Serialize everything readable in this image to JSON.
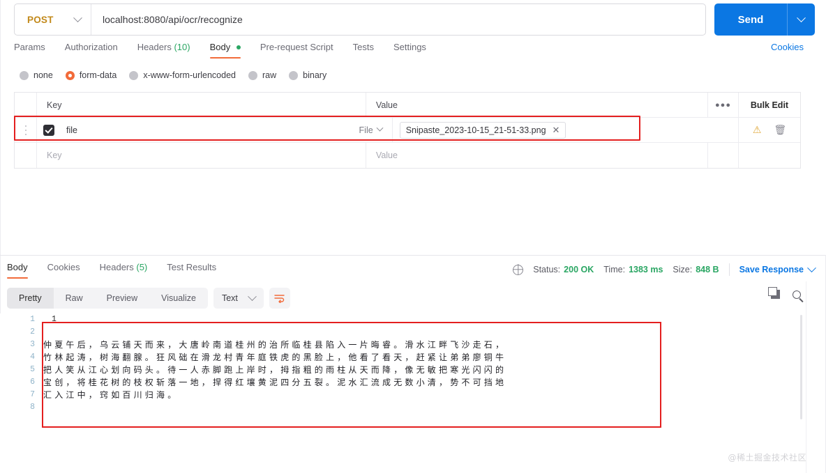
{
  "request": {
    "method": "POST",
    "url": "localhost:8080/api/ocr/recognize",
    "send_label": "Send",
    "tabs": [
      {
        "label": "Params",
        "active": false
      },
      {
        "label": "Authorization",
        "active": false
      },
      {
        "label": "Headers",
        "count": "(10)",
        "active": false
      },
      {
        "label": "Body",
        "active": true,
        "dot": true
      },
      {
        "label": "Pre-request Script",
        "active": false
      },
      {
        "label": "Tests",
        "active": false
      },
      {
        "label": "Settings",
        "active": false
      }
    ],
    "cookies_link": "Cookies",
    "body_types": [
      {
        "label": "none",
        "selected": false
      },
      {
        "label": "form-data",
        "selected": true
      },
      {
        "label": "x-www-form-urlencoded",
        "selected": false
      },
      {
        "label": "raw",
        "selected": false
      },
      {
        "label": "binary",
        "selected": false
      }
    ],
    "table": {
      "headers": {
        "key": "Key",
        "value": "Value",
        "more": "●●●",
        "bulk_edit": "Bulk Edit"
      },
      "rows": [
        {
          "checked": true,
          "key": "file",
          "key_type": "File",
          "value_chip": "Snipaste_2023-10-15_21-51-33.png",
          "chip_close": "✕",
          "warn": "⚠",
          "trash": "🗑"
        }
      ],
      "empty_row": {
        "key_placeholder": "Key",
        "value_placeholder": "Value"
      }
    }
  },
  "response": {
    "tabs": [
      {
        "label": "Body",
        "active": true
      },
      {
        "label": "Cookies",
        "active": false
      },
      {
        "label": "Headers",
        "count": "(5)",
        "active": false
      },
      {
        "label": "Test Results",
        "active": false
      }
    ],
    "meta": {
      "status_label": "Status:",
      "status_value": "200 OK",
      "time_label": "Time:",
      "time_value": "1383 ms",
      "size_label": "Size:",
      "size_value": "848 B",
      "save_response": "Save Response"
    },
    "toolbar": {
      "views": [
        {
          "label": "Pretty",
          "active": true
        },
        {
          "label": "Raw",
          "active": false
        },
        {
          "label": "Preview",
          "active": false
        },
        {
          "label": "Visualize",
          "active": false
        }
      ],
      "format": "Text"
    },
    "body": {
      "line_numbers": [
        "1",
        "2",
        "3",
        "4",
        "5",
        "6",
        "7",
        "8"
      ],
      "lines": [
        {
          "n": 1,
          "text": "1",
          "cjk": false
        },
        {
          "n": 2,
          "text": "",
          "cjk": false
        },
        {
          "n": 3,
          "text": "仲夏午后，乌云铺天而来，大唐岭南道桂州的治所临桂县陷入一片晦睿。滑水江畔飞沙走石，",
          "cjk": true
        },
        {
          "n": 4,
          "text": "竹林起涛，树海翻腺。狂风础在滑龙村青年庭铁虎的黑脸上，他看了看天，赶紧让弟弟廖铜牛",
          "cjk": true
        },
        {
          "n": 5,
          "text": "把人笑从江心划向码头。待一人赤脚跑上岸时，拇指粗的雨柱从天而降，像无敏把寒光闪闪的",
          "cjk": true
        },
        {
          "n": 6,
          "text": "宝创，将桂花树的枝权斩落一地，捍得红壤黄泥四分五裂。泥水汇流成无数小清，势不可挡地",
          "cjk": true
        },
        {
          "n": 7,
          "text": "汇入江中，窍如百川归海。",
          "cjk": true
        },
        {
          "n": 8,
          "text": "",
          "cjk": false
        }
      ]
    }
  },
  "watermark": "@稀土掘金技术社区",
  "colors": {
    "accent_orange": "#f26b3a",
    "send_blue": "#0b77e3",
    "success_green": "#2aa663",
    "method_gold": "#c2891a",
    "highlight_red": "#e41f1f"
  }
}
